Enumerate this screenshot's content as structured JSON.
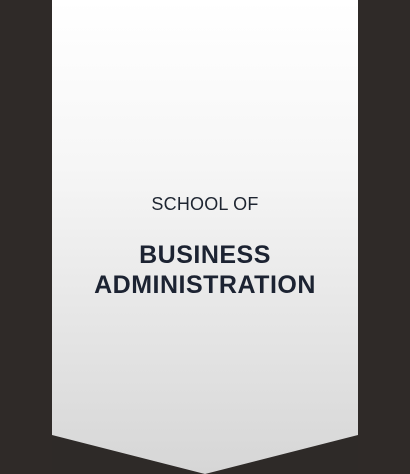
{
  "banner": {
    "subtitle": "SCHOOL OF",
    "title_line1": "BUSINESS",
    "title_line2": "ADMINISTRATION"
  },
  "colors": {
    "background": "#2e2a28",
    "banner_top": "#ffffff",
    "banner_bottom": "#d8d8d8",
    "text": "#1c2332"
  }
}
